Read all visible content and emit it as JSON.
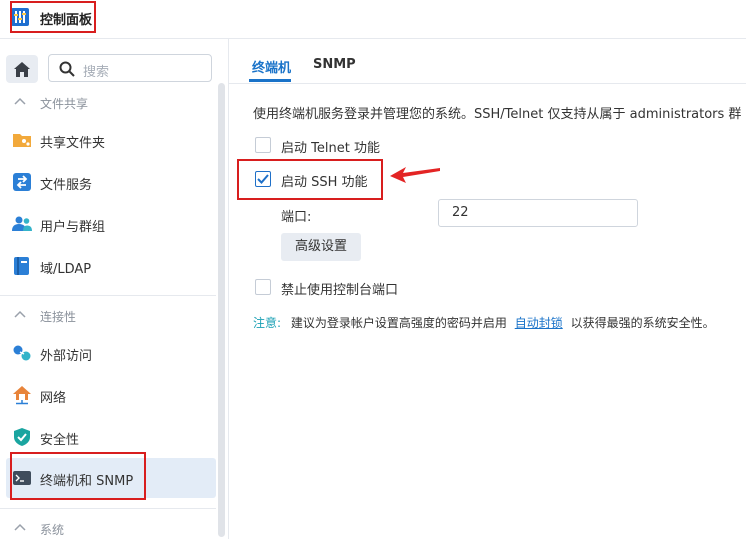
{
  "window": {
    "title": "控制面板"
  },
  "sidebar": {
    "search_placeholder": "搜索",
    "groups": [
      {
        "label": "文件共享"
      },
      {
        "label": "连接性"
      },
      {
        "label": "系统"
      }
    ],
    "items": [
      {
        "label": "共享文件夹",
        "icon": "shared-folder-icon"
      },
      {
        "label": "文件服务",
        "icon": "file-services-icon"
      },
      {
        "label": "用户与群组",
        "icon": "users-groups-icon"
      },
      {
        "label": "域/LDAP",
        "icon": "domain-ldap-icon"
      },
      {
        "label": "外部访问",
        "icon": "external-access-icon"
      },
      {
        "label": "网络",
        "icon": "network-icon"
      },
      {
        "label": "安全性",
        "icon": "security-shield-icon"
      },
      {
        "label": "终端机和 SNMP",
        "icon": "terminal-icon",
        "selected": true
      }
    ]
  },
  "tabs": [
    {
      "label": "终端机",
      "active": true
    },
    {
      "label": "SNMP",
      "active": false
    }
  ],
  "main": {
    "description": "使用终端机服务登录并管理您的系统。SSH/Telnet 仅支持从属于 administrators 群",
    "telnet_label": "启动 Telnet 功能",
    "telnet_checked": false,
    "ssh_label": "启动 SSH 功能",
    "ssh_checked": true,
    "port_label": "端口:",
    "port_value": "22",
    "advanced_button": "高级设置",
    "console_label": "禁止使用控制台端口",
    "console_checked": false,
    "note_label": "注意:",
    "note_text": "建议为登录帐户设置高强度的密码并启用",
    "note_link": "自动封锁",
    "note_tail": "以获得最强的系统安全性。"
  },
  "colors": {
    "accent": "#1a73c9",
    "highlight_red": "#d81e1e",
    "selected_bg": "#e3ecf7",
    "note_teal": "#1aa0b4"
  }
}
